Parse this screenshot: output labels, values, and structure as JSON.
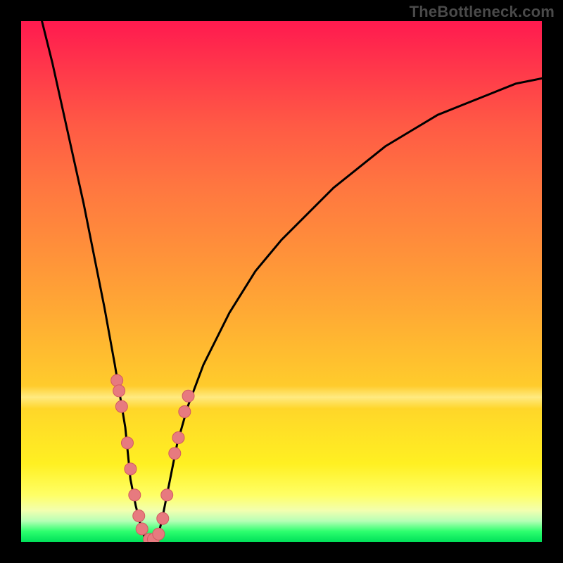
{
  "watermark": "TheBottleneck.com",
  "colors": {
    "curve": "#000000",
    "marker_fill": "#e77a7f",
    "marker_stroke": "#d25a60",
    "frame": "#000000"
  },
  "chart_data": {
    "type": "line",
    "title": "",
    "xlabel": "",
    "ylabel": "",
    "xlim": [
      0,
      100
    ],
    "ylim": [
      0,
      100
    ],
    "grid": false,
    "legend": false,
    "series": [
      {
        "name": "left_curve",
        "x": [
          4,
          6,
          8,
          10,
          12,
          14,
          16,
          18,
          19,
          20,
          20.5,
          21,
          22,
          23,
          24
        ],
        "y": [
          100,
          92,
          83,
          74,
          65,
          55,
          45,
          34,
          28,
          22,
          17,
          12,
          7,
          3,
          0
        ]
      },
      {
        "name": "right_curve",
        "x": [
          26,
          27,
          28,
          29,
          30,
          32,
          35,
          40,
          45,
          50,
          55,
          60,
          65,
          70,
          75,
          80,
          85,
          90,
          95,
          100
        ],
        "y": [
          0,
          4,
          9,
          14,
          19,
          26,
          34,
          44,
          52,
          58,
          63,
          68,
          72,
          76,
          79,
          82,
          84,
          86,
          88,
          89
        ]
      }
    ],
    "markers": [
      {
        "x": 18.4,
        "y": 31
      },
      {
        "x": 18.8,
        "y": 29
      },
      {
        "x": 19.3,
        "y": 26
      },
      {
        "x": 20.4,
        "y": 19
      },
      {
        "x": 21.0,
        "y": 14
      },
      {
        "x": 21.8,
        "y": 9
      },
      {
        "x": 22.6,
        "y": 5
      },
      {
        "x": 23.2,
        "y": 2.5
      },
      {
        "x": 24.6,
        "y": 0.5
      },
      {
        "x": 25.4,
        "y": 0.5
      },
      {
        "x": 26.4,
        "y": 1.5
      },
      {
        "x": 27.2,
        "y": 4.5
      },
      {
        "x": 28.0,
        "y": 9
      },
      {
        "x": 29.5,
        "y": 17
      },
      {
        "x": 30.2,
        "y": 20
      },
      {
        "x": 31.4,
        "y": 25
      },
      {
        "x": 32.1,
        "y": 28
      }
    ]
  }
}
